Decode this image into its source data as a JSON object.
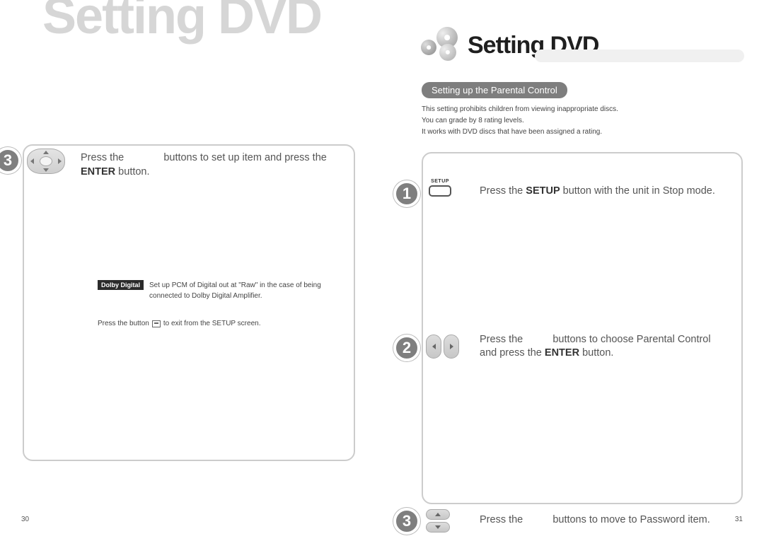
{
  "watermark": "Setting DVD",
  "header": {
    "title": "Setting DVD"
  },
  "left": {
    "page_number": "30",
    "step3": {
      "num": "3",
      "text_a": "Press the ",
      "text_b": " buttons to set up item and press the ",
      "bold": "ENTER",
      "text_c": " button."
    },
    "dolby_label": "Dolby Digital",
    "dolby_text": "Set up PCM of Digital out at \"Raw\" in the case of being connected to Dolby Digital Amplifier.",
    "exit_a": "Press the button ",
    "exit_b": " to exit from the SETUP screen."
  },
  "right": {
    "page_number": "31",
    "sub_title": "Setting up the Parental Control",
    "sub_desc_1": "This setting prohibits children from viewing inappropriate discs.",
    "sub_desc_2": "You can grade by 8 rating levels.",
    "sub_desc_3": "It works with DVD discs that have been assigned a rating.",
    "setup_label": "SETUP",
    "step1": {
      "num": "1",
      "a": "Press the ",
      "bold": "SETUP",
      "b": " button with the unit in Stop mode."
    },
    "step2": {
      "num": "2",
      "a": "Press the ",
      "b": " buttons to choose Parental Control and press the ",
      "bold": "ENTER",
      "c": " button."
    },
    "step3": {
      "num": "3",
      "a": "Press the ",
      "b": " buttons to move to Password item."
    }
  }
}
